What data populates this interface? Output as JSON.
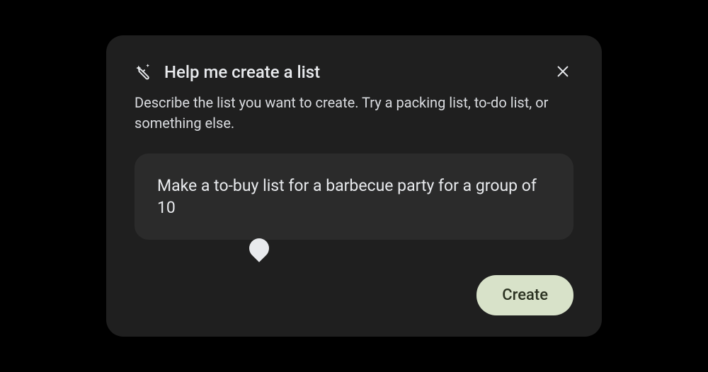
{
  "panel": {
    "title": "Help me create a list",
    "subtitle": "Describe the list you want to create. Try a packing list, to-do list, or something else.",
    "input_value": "Make a to-buy list for a barbecue party for a group of 10",
    "create_label": "Create"
  },
  "colors": {
    "panel_bg": "#1f1f1f",
    "input_bg": "#2b2b2b",
    "text_primary": "#e8eaed",
    "text_secondary": "#dadce0",
    "button_bg": "#d8e2c9",
    "button_text": "#2b3221"
  }
}
